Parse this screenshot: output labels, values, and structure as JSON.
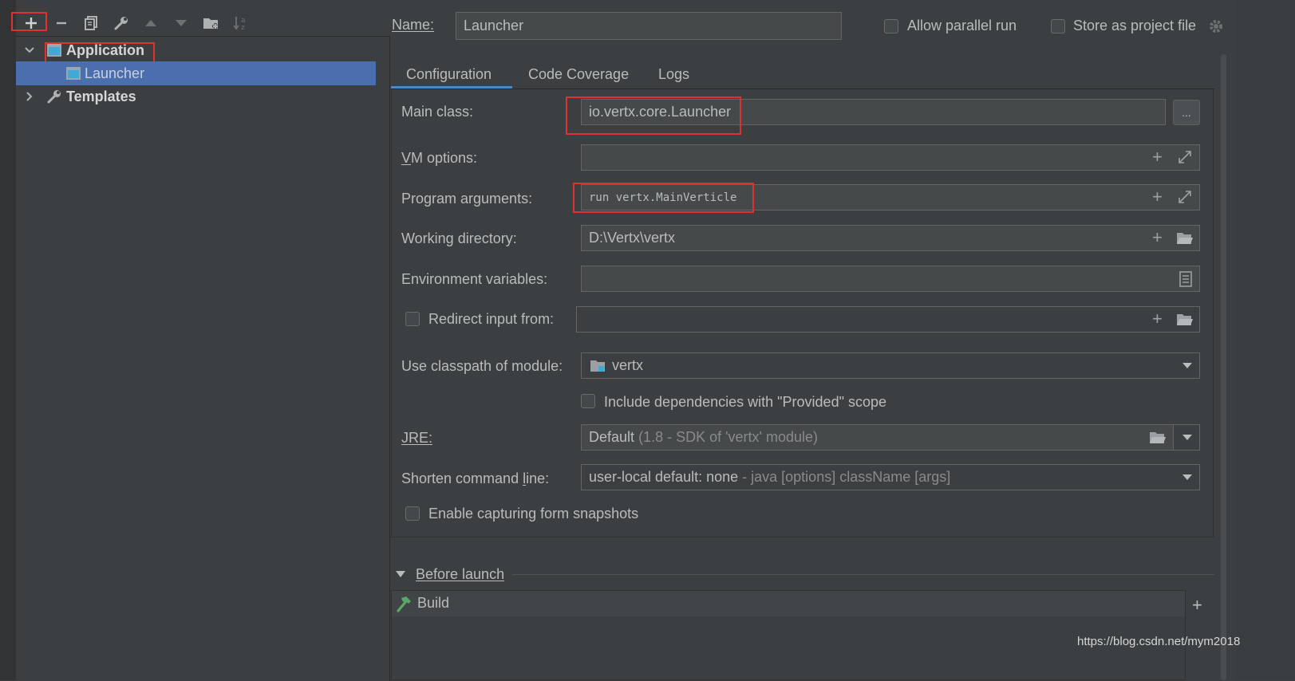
{
  "toolbar": {
    "add": "add-icon",
    "remove": "remove-icon",
    "copy": "copy-icon",
    "edit_defaults": "wrench-icon",
    "move_up": "arrow-up-icon",
    "move_down": "arrow-down-icon",
    "new_folder": "folder-add-icon",
    "sort": "sort-alpha-icon"
  },
  "tree": {
    "application": "Application",
    "launcher": "Launcher",
    "templates": "Templates"
  },
  "header": {
    "name_label": "Name:",
    "name_value": "Launcher",
    "allow_parallel_run": "Allow parallel run",
    "store_as_project_file": "Store as project file"
  },
  "tabs": [
    "Configuration",
    "Code Coverage",
    "Logs"
  ],
  "form": {
    "main_class_label": "Main class:",
    "main_class_value": "io.vertx.core.Launcher",
    "browse_button": "...",
    "vm_options_label": "VM options:",
    "vm_options_value": "",
    "program_arguments_label": "Program arguments:",
    "program_arguments_value": "run vertx.MainVerticle",
    "working_directory_label": "Working directory:",
    "working_directory_value": "D:\\Vertx\\vertx",
    "environment_variables_label": "Environment variables:",
    "environment_variables_value": "",
    "redirect_input_label": "Redirect input from:",
    "classpath_module_label": "Use classpath of module:",
    "classpath_module_value": "vertx",
    "include_dependencies_label": "Include dependencies with \"Provided\" scope",
    "jre_label": "JRE:",
    "jre_value": "Default",
    "jre_hint": "(1.8 - SDK of 'vertx' module)",
    "shorten_label": "Shorten command line:",
    "shorten_value": "user-local default: none",
    "shorten_hint": "- java [options] className [args]",
    "capturing_label": "Enable capturing form snapshots"
  },
  "before_launch": {
    "title": "Before launch",
    "items": [
      "Build"
    ]
  },
  "watermark": "https://blog.csdn.net/mym2018",
  "colors": {
    "selection": "#4b6eaf",
    "highlight_box": "#e0302f",
    "background": "#3c3f41"
  }
}
